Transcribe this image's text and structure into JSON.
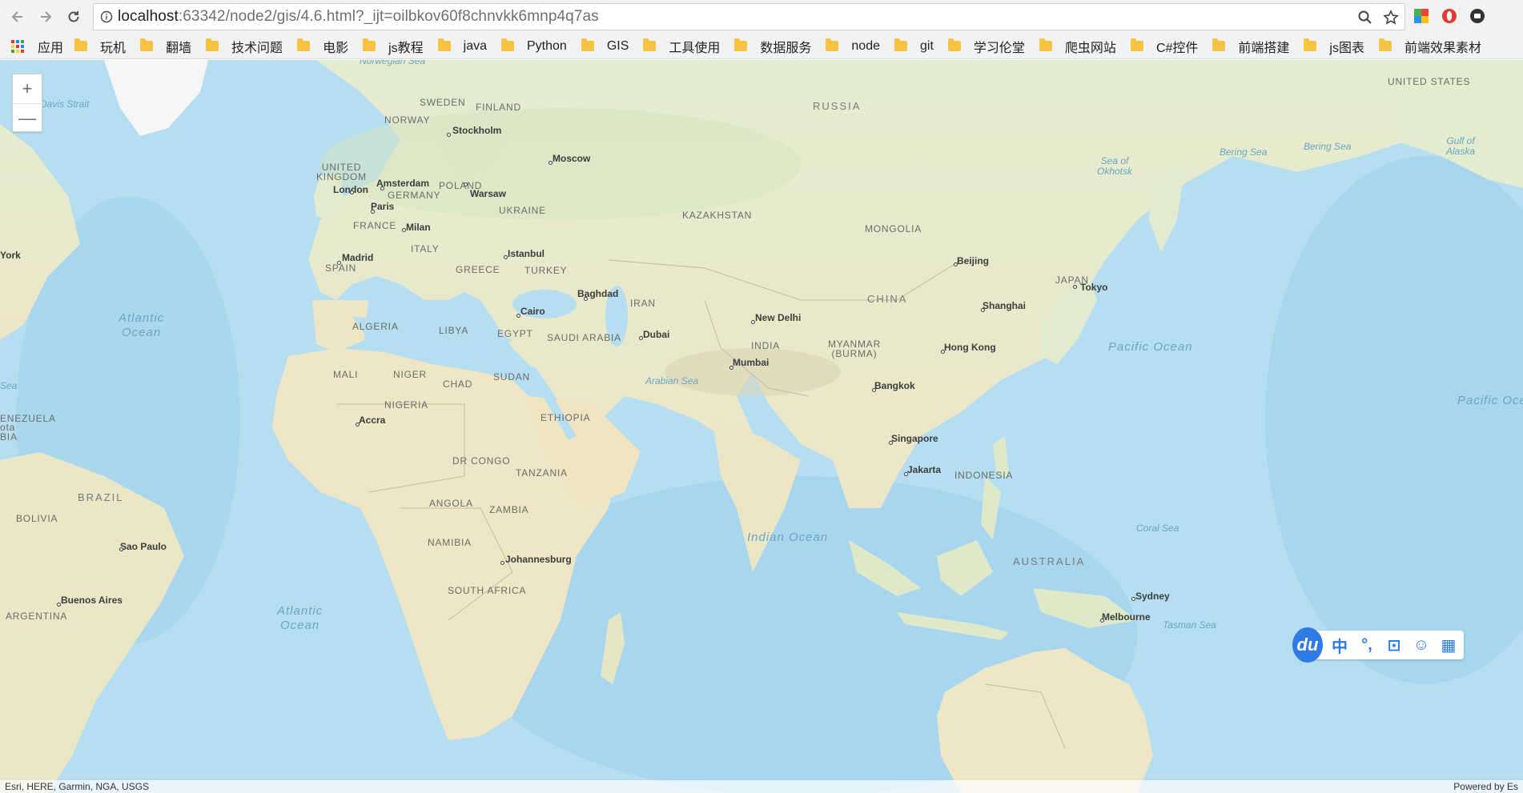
{
  "browser": {
    "url_host": "localhost",
    "url_rest": ":63342/node2/gis/4.6.html?_ijt=oilbkov60f8chnvkk6mnp4q7as"
  },
  "bookmarks": {
    "apps_label": "应用",
    "items": [
      "玩机",
      "翻墙",
      "技术问题",
      "电影",
      "js教程",
      "java",
      "Python",
      "GIS",
      "工具使用",
      "数据服务",
      "node",
      "git",
      "学习伦堂",
      "爬虫网站",
      "C#控件",
      "前端搭建",
      "js图表",
      "前端效果素材"
    ]
  },
  "map": {
    "zoom_in": "+",
    "zoom_out": "—",
    "attribution_left": "Esri, HERE, Garmin, NGA, USGS",
    "attribution_right": "Powered by Es",
    "countries": {
      "russia": "RUSSIA",
      "kazakhstan": "KAZAKHSTAN",
      "mongolia": "MONGOLIA",
      "china": "CHINA",
      "india": "INDIA",
      "iran": "IRAN",
      "saudi": "SAUDI ARABIA",
      "turkey": "TURKEY",
      "egypt": "EGYPT",
      "libya": "LIBYA",
      "algeria": "ALGERIA",
      "mali": "MALI",
      "niger": "NIGER",
      "chad": "CHAD",
      "sudan": "SUDAN",
      "nigeria": "NIGERIA",
      "ethiopia": "ETHIOPIA",
      "drc": "DR CONGO",
      "tanzania": "TANZANIA",
      "angola": "ANGOLA",
      "zambia": "ZAMBIA",
      "namibia": "NAMIBIA",
      "southafrica": "SOUTH AFRICA",
      "brazil": "BRAZIL",
      "bolivia": "BOLIVIA",
      "argentina": "ARGENTINA",
      "venezuela": "ENEZUELA",
      "colombia": "ota",
      "bia": "BIA",
      "australia": "AUSTRALIA",
      "indonesia": "INDONESIA",
      "myanmar": "MYANMAR\n(BURMA)",
      "japan": "JAPAN",
      "usa": "UNITED STATES",
      "sweden": "SWEDEN",
      "finland": "FINLAND",
      "norway": "NORWAY",
      "uk": "UNITED\nKINGDOM",
      "germany": "GERMANY",
      "poland": "POLAND",
      "ukraine": "UKRAINE",
      "france": "FRANCE",
      "italy": "ITALY",
      "spain": "SPAIN",
      "greece": "GREECE"
    },
    "cities": {
      "stockholm": "Stockholm",
      "moscow": "Moscow",
      "amsterdam": "Amsterdam",
      "london": "London",
      "warsaw": "Warsaw",
      "paris": "Paris",
      "milan": "Milan",
      "madrid": "Madrid",
      "istanbul": "Istanbul",
      "baghdad": "Baghdad",
      "cairo": "Cairo",
      "dubai": "Dubai",
      "newdelhi": "New Delhi",
      "mumbai": "Mumbai",
      "beijing": "Beijing",
      "shanghai": "Shanghai",
      "tokyo": "Tokyo",
      "hongkong": "Hong Kong",
      "bangkok": "Bangkok",
      "singapore": "Singapore",
      "jakarta": "Jakarta",
      "accra": "Accra",
      "johannesburg": "Johannesburg",
      "saopaulo": "Sao Paulo",
      "buenosaires": "Buenos Aires",
      "sydney": "Sydney",
      "melbourne": "Melbourne",
      "newyork": "York"
    },
    "waters": {
      "norwegian": "Norwegian Sea",
      "davis": "Davis Strait",
      "atlantic1": "Atlantic\nOcean",
      "atlantic2": "Atlantic\nOcean",
      "arabian": "Arabian Sea",
      "indian": "Indian Ocean",
      "pacific1": "Pacific Ocean",
      "pacific2": "Pacific Oce",
      "okhotsk": "Sea of\nOkhotsk",
      "bering1": "Bering Sea",
      "bering2": "Bering Sea",
      "alaska": "Gulf of\nAlaska",
      "coral": "Coral Sea",
      "tasman": "Tasman Sea",
      "sea_left": "Sea"
    }
  },
  "ime": {
    "logo": "du",
    "tools": [
      "中",
      "°,",
      "⊡",
      "☺",
      "▦"
    ]
  }
}
